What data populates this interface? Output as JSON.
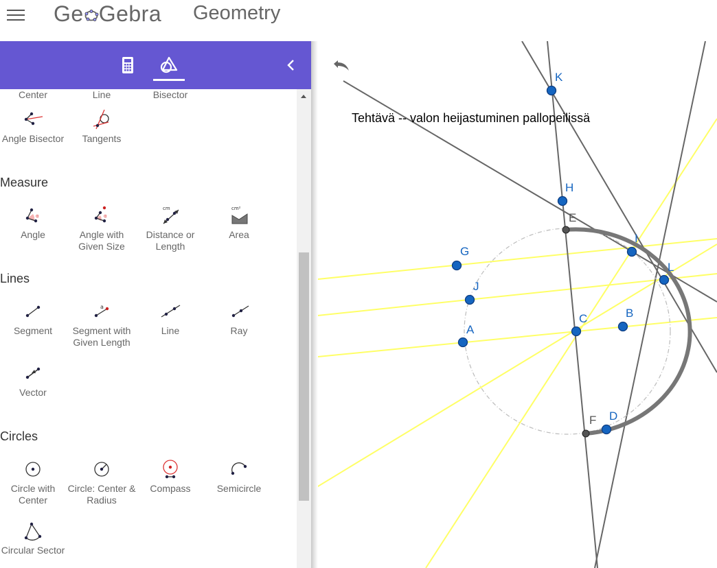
{
  "header": {
    "logo_text_a": "Ge",
    "logo_text_b": "Gebra",
    "app_title": "Geometry"
  },
  "toolbar": {
    "icons": [
      "calculator-icon",
      "geometry-tools-icon",
      "chevron-left-icon"
    ],
    "accent": "#6557d2"
  },
  "tools": {
    "row0": [
      "Center",
      "Line",
      "Bisector"
    ],
    "construct_row": [
      {
        "label": "Angle Bisector",
        "icon": "angle-bisector-icon"
      },
      {
        "label": "Tangents",
        "icon": "tangents-icon"
      }
    ],
    "measure": {
      "title": "Measure",
      "items": [
        {
          "label": "Angle",
          "icon": "angle-icon"
        },
        {
          "label": "Angle with Given Size",
          "icon": "angle-given-size-icon"
        },
        {
          "label": "Distance or Length",
          "icon": "distance-icon"
        },
        {
          "label": "Area",
          "icon": "area-icon"
        }
      ]
    },
    "lines": {
      "title": "Lines",
      "items": [
        {
          "label": "Segment",
          "icon": "segment-icon"
        },
        {
          "label": "Segment with Given Length",
          "icon": "segment-given-length-icon"
        },
        {
          "label": "Line",
          "icon": "line-icon"
        },
        {
          "label": "Ray",
          "icon": "ray-icon"
        },
        {
          "label": "Vector",
          "icon": "vector-icon"
        }
      ]
    },
    "circles": {
      "title": "Circles",
      "items": [
        {
          "label": "Circle with Center",
          "icon": "circle-center-icon"
        },
        {
          "label": "Circle: Center & Radius",
          "icon": "circle-radius-icon"
        },
        {
          "label": "Compass",
          "icon": "compass-icon"
        },
        {
          "label": "Semicircle",
          "icon": "semicircle-icon"
        },
        {
          "label": "Circular Sector",
          "icon": "circular-sector-icon"
        }
      ]
    },
    "icon_labels": {
      "cm": "cm",
      "cm2": "cm²",
      "a": "a",
      "alpha": "α"
    }
  },
  "graphics": {
    "text": "Tehtävä -- valon heijastuminen pallopeilissä",
    "points": {
      "K": "K",
      "H": "H",
      "E": "E",
      "I": "I",
      "L": "L",
      "G": "G",
      "J": "J",
      "C": "C",
      "B": "B",
      "A": "A",
      "F": "F",
      "D": "D"
    },
    "colors": {
      "point_blue": "#1565c0",
      "line_gray": "#666666",
      "ray_yellow": "#ffff66",
      "mirror_arc": "#777777"
    }
  }
}
